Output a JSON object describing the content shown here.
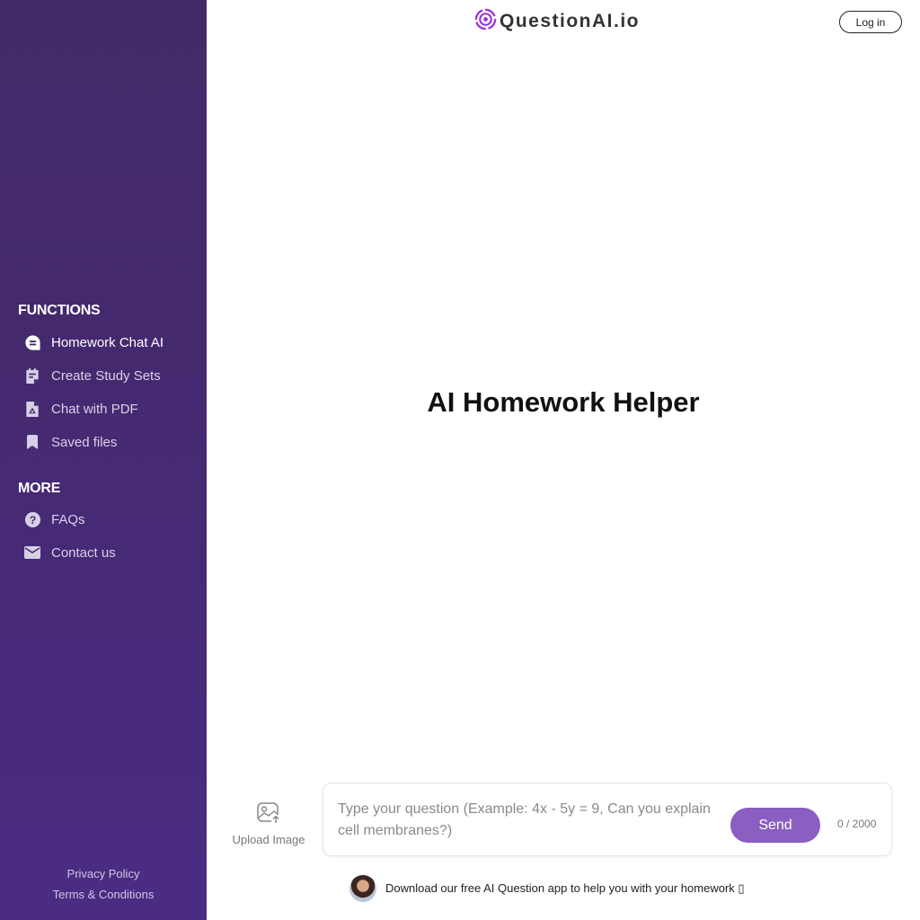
{
  "brand": {
    "name": "QuestionAI.io",
    "accent": "#8b5ec2",
    "logo_color": "#a033d6"
  },
  "header": {
    "login_label": "Log in"
  },
  "sidebar": {
    "sections": [
      {
        "title": "FUNCTIONS",
        "items": [
          {
            "label": "Homework Chat AI",
            "icon": "chat-icon",
            "active": true
          },
          {
            "label": "Create Study Sets",
            "icon": "study-set-icon",
            "active": false
          },
          {
            "label": "Chat with PDF",
            "icon": "pdf-icon",
            "active": false
          },
          {
            "label": "Saved files",
            "icon": "bookmark-icon",
            "active": false
          }
        ]
      },
      {
        "title": "MORE",
        "items": [
          {
            "label": "FAQs",
            "icon": "question-icon",
            "active": false
          },
          {
            "label": "Contact us",
            "icon": "mail-icon",
            "active": false
          }
        ]
      }
    ],
    "footer": {
      "privacy": "Privacy Policy",
      "terms": "Terms & Conditions"
    },
    "colors": {
      "top": "#422a6a",
      "bottom": "#4a2c84"
    }
  },
  "main": {
    "title": "AI Homework Helper",
    "upload_label": "Upload Image",
    "input": {
      "value": "",
      "placeholder": "Type your question (Example: 4x - 5y = 9, Can you explain cell membranes?)"
    },
    "send_label": "Send",
    "char_count": "0 / 2000",
    "promo_text": "Download our free AI Question app to help you with your homework ▯"
  }
}
